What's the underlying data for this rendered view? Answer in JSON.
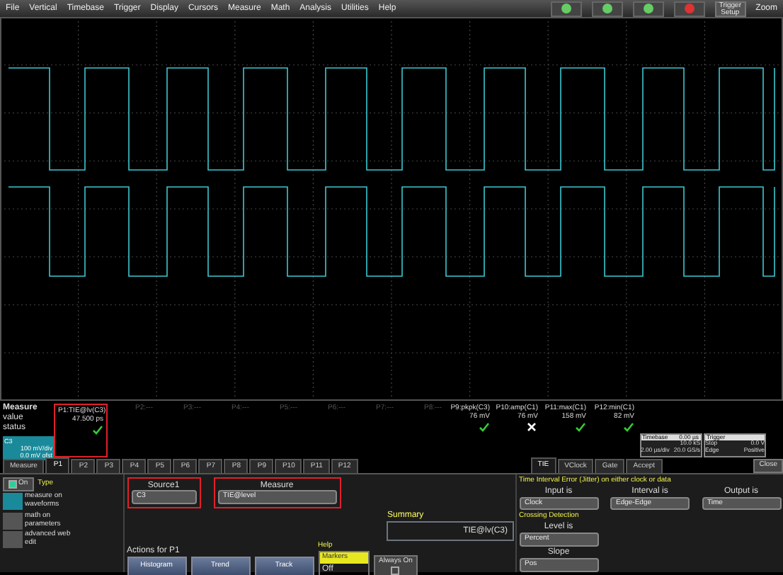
{
  "menu": [
    "File",
    "Vertical",
    "Timebase",
    "Trigger",
    "Display",
    "Cursors",
    "Measure",
    "Math",
    "Analysis",
    "Utilities",
    "Help"
  ],
  "toolbar": {
    "trigger_setup": "Trigger Setup",
    "zoom": "Zoom"
  },
  "measure_table": {
    "row_labels": [
      "Measure",
      "value",
      "status"
    ],
    "params": [
      {
        "label": "P1:TIE@lv(C3)",
        "value": "47.500 ps",
        "passed": true,
        "selected": true
      },
      {
        "label": "P2:---",
        "selected": false
      },
      {
        "label": "P3:---",
        "selected": false
      },
      {
        "label": "P4:---",
        "selected": false
      },
      {
        "label": "P5:---",
        "selected": false
      },
      {
        "label": "P6:---",
        "selected": false
      },
      {
        "label": "P7:---",
        "selected": false
      },
      {
        "label": "P8:---",
        "selected": false
      },
      {
        "label": "P9:pkpk(C3)",
        "value": "76 mV",
        "passed": true,
        "selected": false
      },
      {
        "label": "P10:amp(C1)",
        "value": "76 mV",
        "passed": false,
        "selected": false
      },
      {
        "label": "P11:max(C1)",
        "value": "158 mV",
        "passed": true,
        "selected": false
      },
      {
        "label": "P12:min(C1)",
        "value": "82 mV",
        "passed": true,
        "selected": false
      }
    ]
  },
  "channel": {
    "name": "C3",
    "scale": "100 mV/div",
    "offset": "0.0 mV ofst"
  },
  "timebase": {
    "title": "Timebase",
    "delay": "0.00 µs",
    "samples": "10.0 kS",
    "div": "2.00 µs/div",
    "rate": "20.0 GS/s"
  },
  "trigger": {
    "title": "Trigger",
    "mode": "Stop",
    "level": "0.0 V",
    "type": "Edge",
    "slope": "Positive"
  },
  "tabs": [
    {
      "label": "Measure",
      "selected": false
    },
    {
      "label": "P1",
      "selected": true
    },
    {
      "label": "P2",
      "selected": false
    },
    {
      "label": "P3",
      "selected": false
    },
    {
      "label": "P4",
      "selected": false
    },
    {
      "label": "P5",
      "selected": false
    },
    {
      "label": "P6",
      "selected": false
    },
    {
      "label": "P7",
      "selected": false
    },
    {
      "label": "P8",
      "selected": false
    },
    {
      "label": "P9",
      "selected": false
    },
    {
      "label": "P10",
      "selected": false
    },
    {
      "label": "P11",
      "selected": false
    },
    {
      "label": "P12",
      "selected": false
    }
  ],
  "param_panel": {
    "on": {
      "label": "On",
      "checked": true
    },
    "type_label": "Type",
    "types": [
      {
        "label": "measure on waveforms",
        "selected": true
      },
      {
        "label": "math on parameters",
        "selected": false
      },
      {
        "label": "advanced web edit",
        "selected": false
      }
    ],
    "source_label": "Source1",
    "source": "C3",
    "measure_label": "Measure",
    "measure": "TIE@level",
    "summary_label": "Summary",
    "summary": "TIE@lv(C3)",
    "actions_label": "Actions for P1",
    "actions": [
      "Histogram",
      "Trend",
      "Track"
    ],
    "help_label": "Help",
    "markers_label": "Markers",
    "markers": "Off",
    "always_on": {
      "label": "Always On",
      "checked": false
    }
  },
  "tie_panel": {
    "tabs": [
      {
        "label": "TIE",
        "selected": true
      },
      {
        "label": "VClock",
        "selected": false
      },
      {
        "label": "Gate",
        "selected": false
      },
      {
        "label": "Accept",
        "selected": false
      }
    ],
    "close": "Close",
    "description": "Time Interval Error (Jitter) on either clock or data",
    "input_label": "Input is",
    "input": "Clock",
    "interval_label": "Interval is",
    "interval": "Edge-Edge",
    "output_label": "Output is",
    "output": "Time",
    "crossing_label": "Crossing Detection",
    "level_label": "Level is",
    "level": "Percent",
    "slope_label": "Slope",
    "slope": "Pos"
  }
}
